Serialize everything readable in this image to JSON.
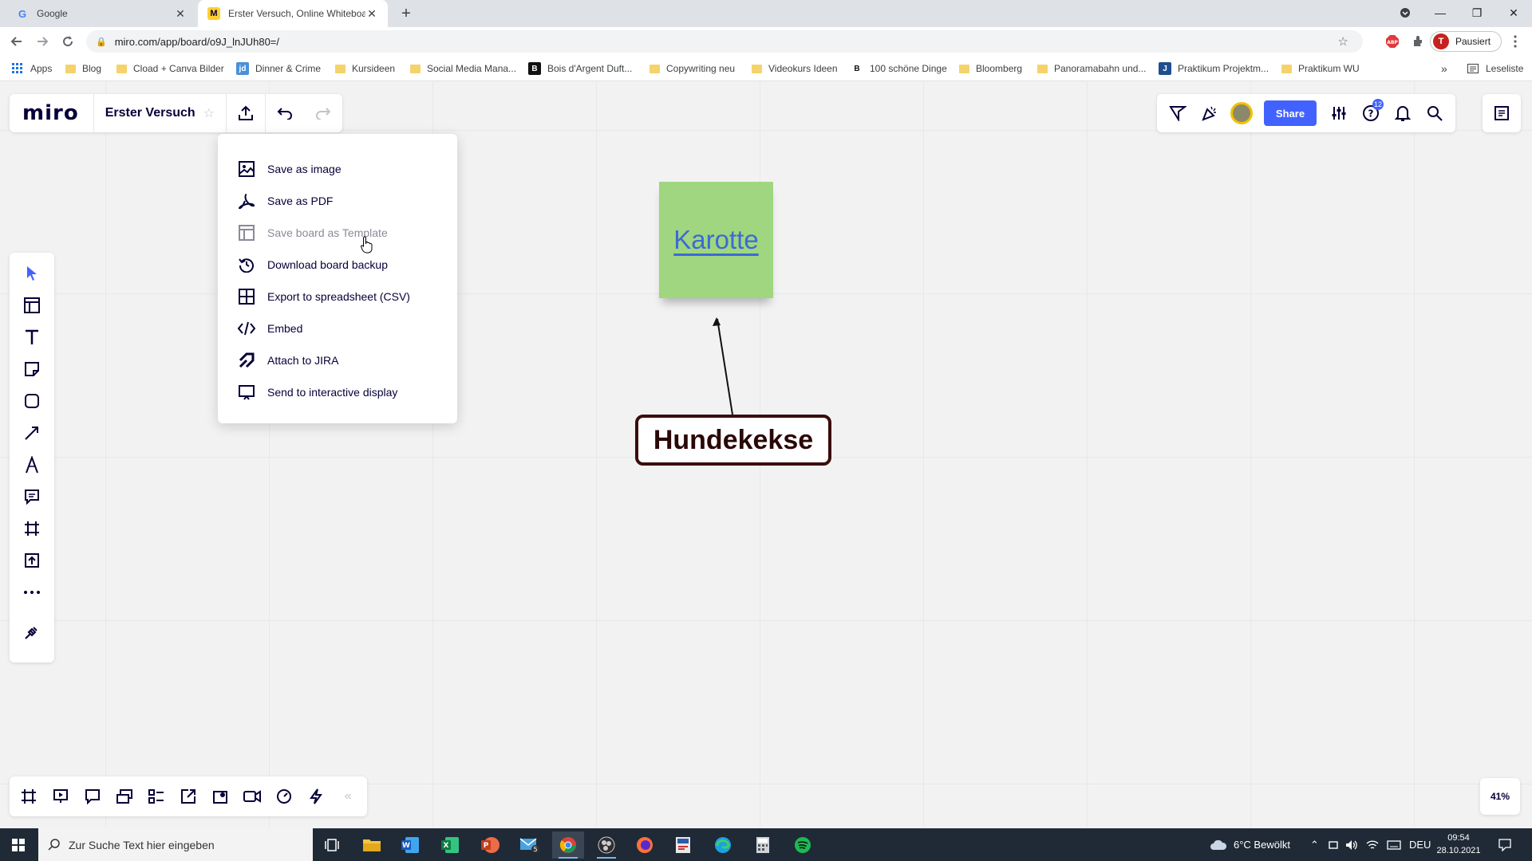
{
  "browser": {
    "tabs": [
      {
        "label": "Google",
        "active": false
      },
      {
        "label": "Erster Versuch, Online Whiteboar",
        "active": true
      }
    ],
    "address": "miro.com/app/board/o9J_lnJUh80=/",
    "profile_label": "Pausiert",
    "profile_initial": "T",
    "bookmarks": [
      {
        "label": "Apps"
      },
      {
        "label": "Blog"
      },
      {
        "label": "Cload + Canva Bilder"
      },
      {
        "label": "Dinner & Crime"
      },
      {
        "label": "Kursideen"
      },
      {
        "label": "Social Media Mana..."
      },
      {
        "label": "Bois d'Argent Duft..."
      },
      {
        "label": "Copywriting neu"
      },
      {
        "label": "Videokurs Ideen"
      },
      {
        "label": "100 schöne Dinge"
      },
      {
        "label": "Bloomberg"
      },
      {
        "label": "Panoramabahn und..."
      },
      {
        "label": "Praktikum Projektm..."
      },
      {
        "label": "Praktikum WU"
      }
    ],
    "reading_list": "Leseliste",
    "more_bookmarks": "»"
  },
  "miro": {
    "logo": "miro",
    "board_title": "Erster Versuch",
    "share_label": "Share",
    "help_badge": "12",
    "zoom": "41%",
    "export_menu": [
      {
        "label": "Save as image",
        "icon": "image-icon"
      },
      {
        "label": "Save as PDF",
        "icon": "pdf-icon"
      },
      {
        "label": "Save board as Template",
        "icon": "template-icon"
      },
      {
        "label": "Download board backup",
        "icon": "backup-icon"
      },
      {
        "label": "Export to spreadsheet (CSV)",
        "icon": "spreadsheet-icon"
      },
      {
        "label": "Embed",
        "icon": "code-icon"
      },
      {
        "label": "Attach to JIRA",
        "icon": "jira-icon"
      },
      {
        "label": "Send to interactive display",
        "icon": "display-icon"
      }
    ],
    "canvas": {
      "sticky_text": "Karotte",
      "box_text": "Hundekekse"
    }
  },
  "taskbar": {
    "search_placeholder": "Zur Suche Text hier eingeben",
    "weather": "6°C  Bewölkt",
    "language": "DEU",
    "time": "09:54",
    "date": "28.10.2021",
    "mail_badge": "5"
  },
  "colors": {
    "miro_blue": "#4262ff",
    "sticky_green": "#9fd67f",
    "link_blue": "#3c6ad6",
    "box_border": "#3b0d0d"
  }
}
